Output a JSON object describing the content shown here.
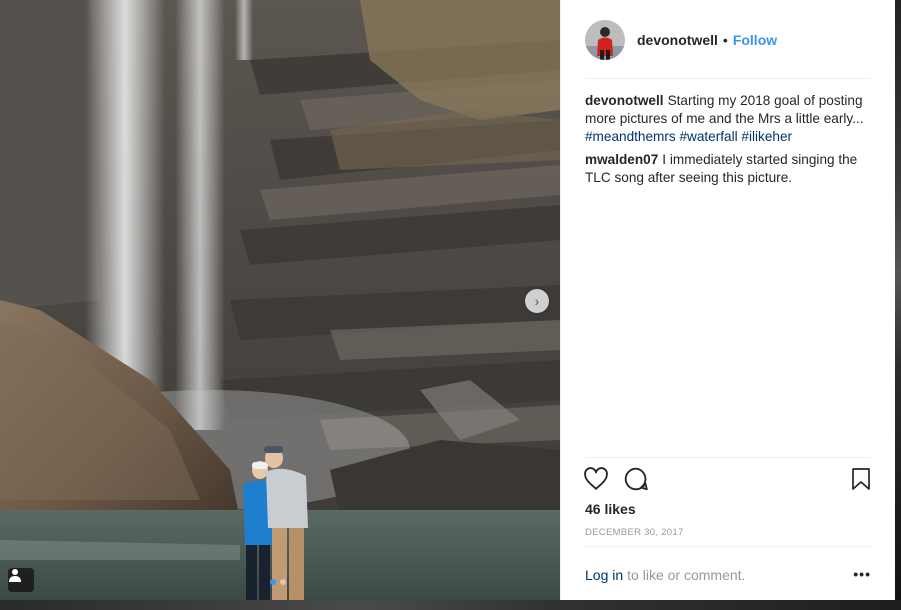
{
  "post": {
    "username": "devonotwell",
    "separator": "•",
    "follow_label": "Follow",
    "comments": [
      {
        "author": "devonotwell",
        "text": "Starting my 2018 goal of posting more pictures of me and the Mrs a little early...",
        "hashtags": [
          "#meandthemrs",
          "#waterfall",
          "#ilikeher"
        ]
      },
      {
        "author": "mwalden07",
        "text": "I immediately started singing the TLC song after seeing this picture.",
        "hashtags": []
      }
    ],
    "likes": "46 likes",
    "date": "DECEMBER 30, 2017",
    "login_label": "Log in",
    "login_suffix": "to like or comment.",
    "more_label": "•••"
  },
  "media": {
    "slides": 2,
    "active_slide": 0,
    "next_icon": "chevron-right-icon",
    "tag_icon": "person-tag-icon"
  },
  "icons": {
    "like": "heart-icon",
    "comment": "comment-bubble-icon",
    "save": "bookmark-icon"
  },
  "colors": {
    "link": "#003569",
    "follow": "#3897f0",
    "text": "#262626",
    "muted": "#999999"
  }
}
